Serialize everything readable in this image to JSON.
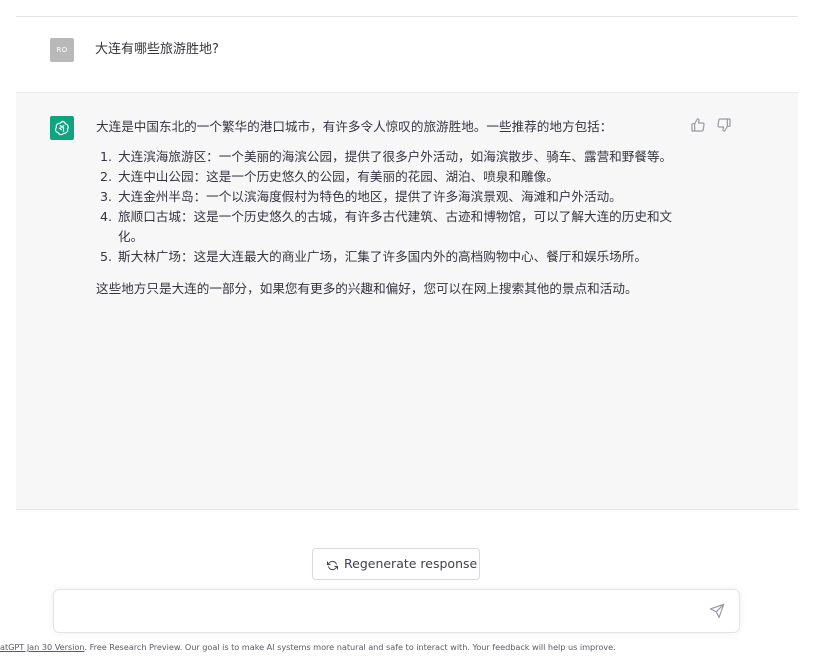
{
  "conversation": {
    "user_message": {
      "avatar_initials": "RO",
      "text": "大连有哪些旅游胜地?"
    },
    "assistant_message": {
      "intro": "大连是中国东北的一个繁华的港口城市，有许多令人惊叹的旅游胜地。一些推荐的地方包括：",
      "items": [
        "大连滨海旅游区：一个美丽的海滨公园，提供了很多户外活动，如海滨散步、骑车、露营和野餐等。",
        "大连中山公园：这是一个历史悠久的公园，有美丽的花园、湖泊、喷泉和雕像。",
        "大连金州半岛：一个以滨海度假村为特色的地区，提供了许多海滨景观、海滩和户外活动。",
        "旅顺口古城：这是一个历史悠久的古城，有许多古代建筑、古迹和博物馆，可以了解大连的历史和文化。",
        "斯大林广场：这是大连最大的商业广场，汇集了许多国内外的高档购物中心、餐厅和娱乐场所。"
      ],
      "outro": "这些地方只是大连的一部分，如果您有更多的兴趣和偏好，您可以在网上搜索其他的景点和活动。",
      "feedback_icons": [
        "thumbs-up-icon",
        "thumbs-down-icon"
      ]
    }
  },
  "actions": {
    "regenerate_label": "Regenerate response",
    "regenerate_icon": "refresh-icon"
  },
  "composer": {
    "placeholder": "",
    "send_icon": "send-icon"
  },
  "footer": {
    "version_link": "atGPT Jan 30 Version",
    "text": ". Free Research Preview. Our goal is to make AI systems more natural and safe to interact with. Your feedback will help us improve."
  },
  "colors": {
    "gpt_avatar": "#10a37f",
    "user_avatar": "#b9b9b9",
    "assistant_bg": "#f7f7f8",
    "text": "#343541"
  }
}
